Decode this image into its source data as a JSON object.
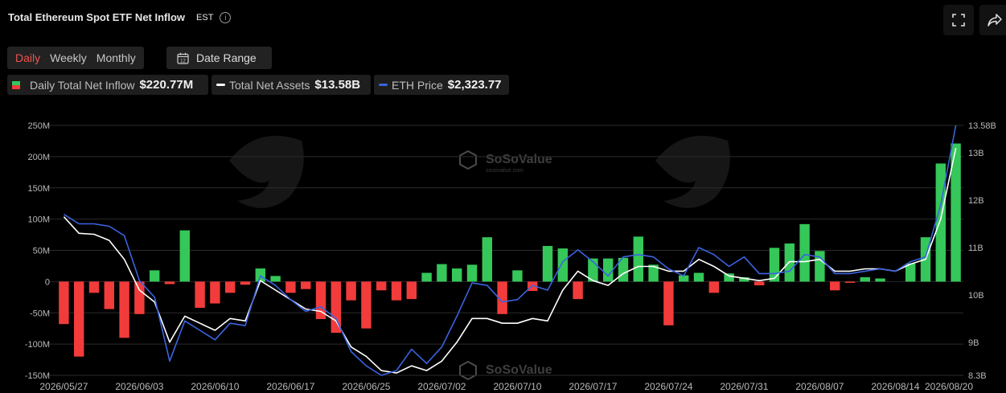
{
  "header": {
    "title": "Total Ethereum Spot ETF Net Inflow",
    "timezone": "EST",
    "info_icon": "info-icon",
    "fullscreen_icon": "fullscreen-icon",
    "share_icon": "share-icon"
  },
  "controls": {
    "periods": [
      "Daily",
      "Weekly",
      "Monthly"
    ],
    "active_period": "Daily",
    "date_range_label": "Date Range",
    "date_range_icon": "calendar-icon"
  },
  "legend": {
    "inflow": {
      "label": "Daily Total Net Inflow",
      "value": "$220.77M"
    },
    "assets": {
      "label": "Total Net Assets",
      "value": "$13.58B"
    },
    "price": {
      "label": "ETH Price",
      "value": "$2,323.77"
    }
  },
  "watermark": {
    "brand": "SoSoValue",
    "site": "sosovalue.com"
  },
  "colors": {
    "positive": "#35c759",
    "negative": "#f23b3b",
    "assets_line": "#ffffff",
    "price_line": "#3a63e0",
    "accent": "#ef5350"
  },
  "chart_data": {
    "type": "bar",
    "x_tick_labels": [
      "2026/05/27",
      "2026/06/03",
      "2026/06/10",
      "2026/06/17",
      "2026/06/25",
      "2026/07/02",
      "2026/07/10",
      "2026/07/17",
      "2026/07/24",
      "2026/07/31",
      "2026/08/07",
      "2026/08/14",
      "2026/08/20"
    ],
    "x_tick_index": [
      0,
      5,
      10,
      15,
      20,
      25,
      30,
      35,
      40,
      45,
      50,
      55,
      59
    ],
    "y_left": {
      "ylim": [
        -150,
        250
      ],
      "ticks": [
        -150,
        -100,
        -50,
        0,
        50,
        100,
        150,
        200,
        250
      ],
      "tick_labels": [
        "-150M",
        "-100M",
        "-50M",
        "0",
        "50M",
        "100M",
        "150M",
        "200M",
        "250M"
      ]
    },
    "y_right": {
      "ylim": [
        8.3,
        13.58
      ],
      "ticks": [
        8.3,
        9,
        10,
        11,
        12,
        13,
        13.58
      ],
      "tick_labels": [
        "8.3B",
        "9B",
        "10B",
        "11B",
        "12B",
        "13B",
        "13.58B"
      ]
    },
    "series": [
      {
        "name": "Daily Total Net Inflow",
        "type": "bar",
        "axis": "left",
        "values": [
          -68,
          -120,
          -18,
          -44,
          -90,
          -52,
          18,
          -4,
          82,
          -42,
          -35,
          -18,
          -5,
          21,
          9,
          -18,
          -12,
          -60,
          -82,
          -30,
          -75,
          -14,
          -30,
          -28,
          14,
          28,
          21,
          27,
          71,
          -52,
          18,
          -15,
          57,
          53,
          -28,
          37,
          37,
          38,
          72,
          27,
          -70,
          10,
          14,
          -18,
          13,
          7,
          -6,
          54,
          61,
          92,
          49,
          -14,
          -2,
          7,
          5,
          0,
          29,
          71,
          189,
          221
        ]
      },
      {
        "name": "Total Net Assets",
        "type": "line",
        "axis": "right",
        "values": [
          11.65,
          11.3,
          11.28,
          11.15,
          10.75,
          10.1,
          9.85,
          9.0,
          9.55,
          9.4,
          9.25,
          9.5,
          9.45,
          10.3,
          10.1,
          9.9,
          9.7,
          9.65,
          9.45,
          8.9,
          8.7,
          8.4,
          8.35,
          8.5,
          8.4,
          8.6,
          9.0,
          9.5,
          9.5,
          9.4,
          9.4,
          9.5,
          9.45,
          10.1,
          10.5,
          10.3,
          10.2,
          10.45,
          10.6,
          10.6,
          10.5,
          10.5,
          10.75,
          10.6,
          10.4,
          10.35,
          10.3,
          10.35,
          10.7,
          10.7,
          10.75,
          10.5,
          10.5,
          10.55,
          10.55,
          10.5,
          10.65,
          10.75,
          11.6,
          13.1
        ]
      },
      {
        "name": "ETH Price",
        "type": "line",
        "axis": "right",
        "values": [
          11.7,
          11.5,
          11.5,
          11.45,
          11.25,
          10.3,
          9.95,
          8.6,
          9.45,
          9.25,
          9.05,
          9.4,
          9.35,
          10.4,
          10.2,
          9.9,
          9.65,
          9.75,
          9.5,
          8.8,
          8.5,
          8.3,
          8.4,
          8.85,
          8.55,
          8.9,
          9.55,
          10.25,
          10.2,
          9.85,
          9.9,
          10.2,
          10.1,
          10.7,
          10.95,
          10.7,
          10.4,
          10.8,
          10.85,
          10.8,
          10.55,
          10.4,
          11.0,
          10.85,
          10.6,
          10.8,
          10.45,
          10.45,
          10.5,
          10.85,
          10.8,
          10.45,
          10.45,
          10.5,
          10.55,
          10.5,
          10.7,
          10.8,
          11.9,
          13.58
        ]
      }
    ]
  }
}
